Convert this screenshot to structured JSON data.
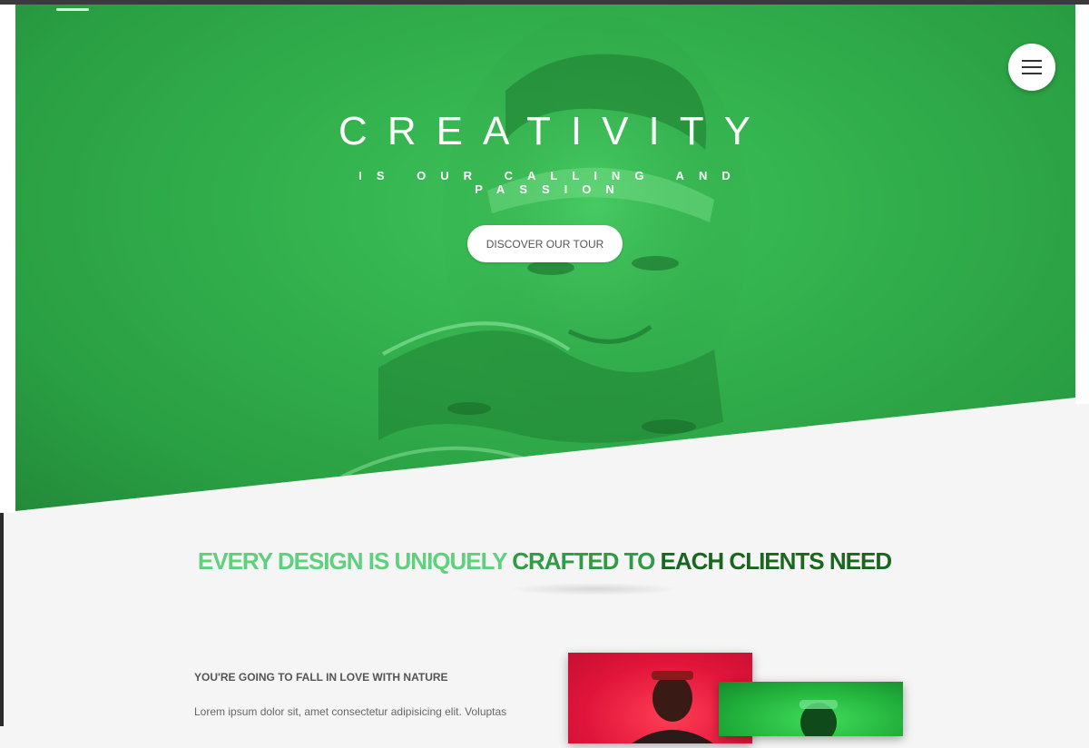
{
  "hero": {
    "title": "CREATIVITY",
    "subtitle": "IS OUR CALLING AND PASSION",
    "cta_label": "DISCOVER OUR TOUR"
  },
  "nav": {
    "menu_icon": "hamburger-menu-icon"
  },
  "tagline": {
    "part1": "EVERY DESIGN IS UNIQUELY ",
    "part2": "CRAFTED TO ",
    "part3": "EACH CLIENTS NEED"
  },
  "section": {
    "heading": "YOU'RE GOING TO FALL IN LOVE WITH NATURE",
    "body": "Lorem ipsum dolor sit, amet consectetur adipisicing elit. Voluptas"
  },
  "colors": {
    "accent_green": "#2f9b45",
    "light_green": "#5fd17e",
    "dark_green": "#19661f",
    "photo_red": "#e0143a"
  }
}
